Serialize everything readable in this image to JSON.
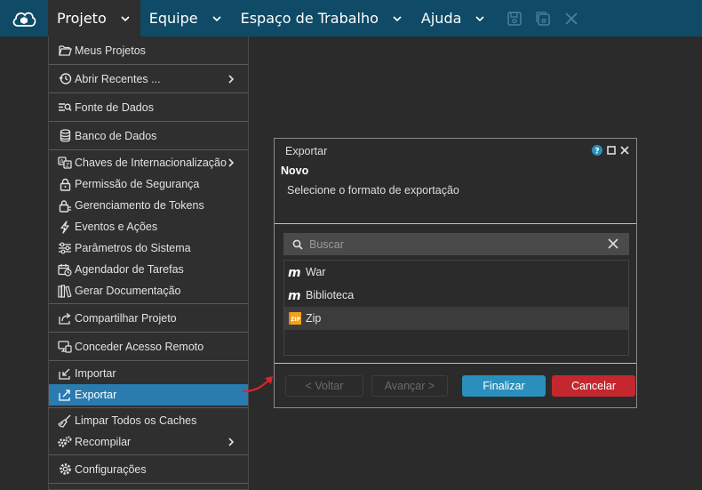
{
  "topbar": {
    "menus": [
      {
        "label": "Projeto"
      },
      {
        "label": "Equipe"
      },
      {
        "label": "Espaço de Trabalho"
      },
      {
        "label": "Ajuda"
      }
    ],
    "icons": [
      "save-icon",
      "save-all-icon",
      "close-icon"
    ]
  },
  "dropdown": {
    "groups": [
      [
        {
          "label": "Meus Projetos",
          "icon": "folder-open-icon"
        }
      ],
      [
        {
          "label": "Abrir Recentes ...",
          "icon": "history-icon",
          "submenu": true
        }
      ],
      [
        {
          "label": "Fonte de Dados",
          "icon": "datasource-icon"
        }
      ],
      [
        {
          "label": "Banco de Dados",
          "icon": "database-icon"
        }
      ],
      [
        {
          "label": "Chaves de Internacionalização",
          "icon": "translate-icon",
          "submenu": true
        },
        {
          "label": "Permissão de Segurança",
          "icon": "lock-icon"
        },
        {
          "label": "Gerenciamento de Tokens",
          "icon": "token-lock-icon"
        },
        {
          "label": "Eventos e Ações",
          "icon": "lightning-icon"
        },
        {
          "label": "Parâmetros do Sistema",
          "icon": "sliders-icon"
        },
        {
          "label": "Agendador de Tarefas",
          "icon": "calendar-clock-icon"
        },
        {
          "label": "Gerar Documentação",
          "icon": "books-icon"
        }
      ],
      [
        {
          "label": "Compartilhar Projeto",
          "icon": "share-icon"
        }
      ],
      [
        {
          "label": "Conceder Acesso Remoto",
          "icon": "remote-access-icon"
        }
      ],
      [
        {
          "label": "Importar",
          "icon": "import-icon"
        },
        {
          "label": "Exportar",
          "icon": "export-icon",
          "active": true
        }
      ],
      [
        {
          "label": "Limpar Todos os Caches",
          "icon": "broom-icon"
        },
        {
          "label": "Recompilar",
          "icon": "gears-icon",
          "submenu": true
        }
      ],
      [
        {
          "label": "Configurações",
          "icon": "gear-icon"
        }
      ]
    ]
  },
  "dialog": {
    "title": "Exportar",
    "heading": "Novo",
    "subtitle": "Selecione o formato de exportação",
    "search_placeholder": "Buscar",
    "items": [
      {
        "label": "War",
        "icon": "m-logo-icon"
      },
      {
        "label": "Biblioteca",
        "icon": "m-logo-icon"
      },
      {
        "label": "Zip",
        "icon": "zip-icon",
        "selected": true
      }
    ],
    "buttons": {
      "back": "< Voltar",
      "next": "Avançar >",
      "finish": "Finalizar",
      "cancel": "Cancelar"
    },
    "colors": {
      "primary": "#2a8fbd",
      "danger": "#c4272e"
    }
  }
}
